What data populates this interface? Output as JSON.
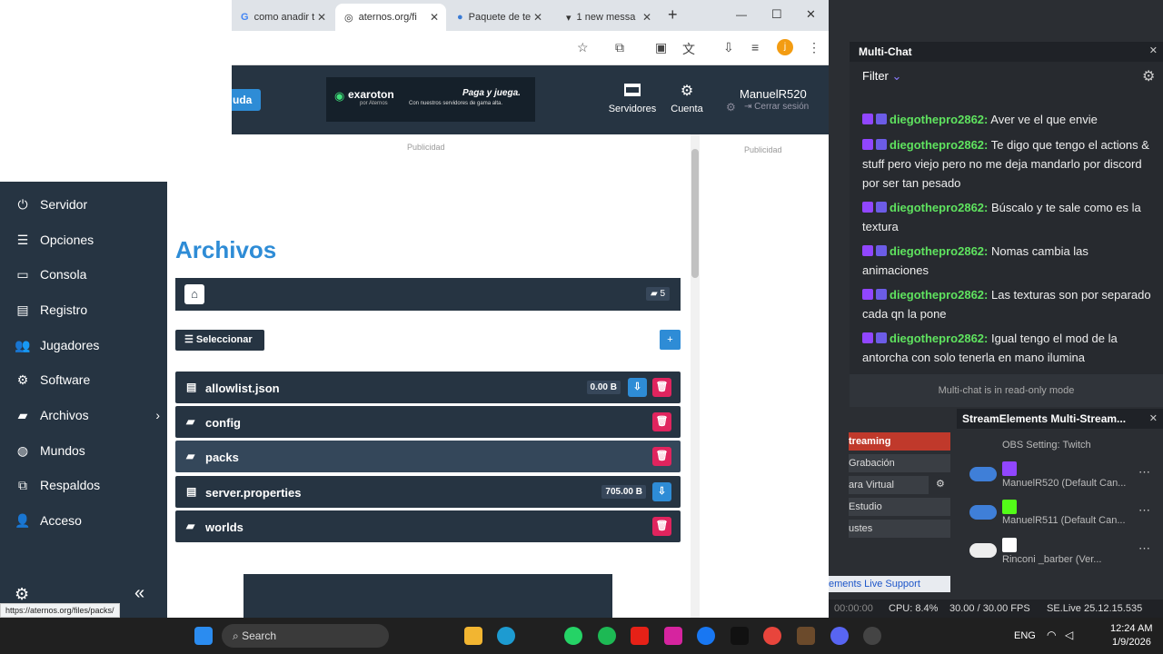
{
  "browser": {
    "tabs": [
      {
        "title": "como anadir t"
      },
      {
        "title": "aternos.org/fi"
      },
      {
        "title": "Paquete de te"
      },
      {
        "title": "1 new messa"
      }
    ],
    "new_tab": "+",
    "window_controls": {
      "min": "—",
      "max": "☐",
      "close": "✕"
    },
    "status_url": "https://aternos.org/files/packs/"
  },
  "site": {
    "ayuda": "uda",
    "ad": {
      "brand": "exaroton",
      "brand_sub": "por Aternos",
      "headline": "Paga y juega.",
      "sub": "Con nuestros servidores de gama alta."
    },
    "servidores": "Servidores",
    "cuenta": "Cuenta",
    "username": "ManuelR520",
    "logout": "Cerrar sesión",
    "publicidad": "Publicidad",
    "page_title": "Archivos",
    "folder_count": "5",
    "select_button": "Seleccionar",
    "files": [
      {
        "name": "allowlist.json",
        "type": "file",
        "size": "0.00 B"
      },
      {
        "name": "config",
        "type": "folder",
        "size": ""
      },
      {
        "name": "packs",
        "type": "folder",
        "size": ""
      },
      {
        "name": "server.properties",
        "type": "file",
        "size": "705.00 B"
      },
      {
        "name": "worlds",
        "type": "folder",
        "size": ""
      }
    ]
  },
  "sidebar": {
    "items": [
      {
        "label": "Servidor",
        "icon": "power-icon"
      },
      {
        "label": "Opciones",
        "icon": "list-icon"
      },
      {
        "label": "Consola",
        "icon": "terminal-icon"
      },
      {
        "label": "Registro",
        "icon": "file-icon"
      },
      {
        "label": "Jugadores",
        "icon": "users-icon"
      },
      {
        "label": "Software",
        "icon": "gears-icon"
      },
      {
        "label": "Archivos",
        "icon": "folder-icon"
      },
      {
        "label": "Mundos",
        "icon": "globe-icon"
      },
      {
        "label": "Respaldos",
        "icon": "clone-icon"
      },
      {
        "label": "Acceso",
        "icon": "user-icon"
      }
    ]
  },
  "stream": {
    "overlay_name": "manuelR520"
  },
  "multichat": {
    "title": "Multi-Chat",
    "filter": "Filter",
    "messages": [
      {
        "user": "diegothepro2862:",
        "text": "Aver ve el que envie"
      },
      {
        "user": "diegothepro2862:",
        "text": "Te digo que tengo el actions & stuff pero viejo pero no me deja mandarlo por discord por ser tan pesado"
      },
      {
        "user": "diegothepro2862:",
        "text": "Búscalo y te sale como es la textura"
      },
      {
        "user": "diegothepro2862:",
        "text": "Nomas cambia las animaciones"
      },
      {
        "user": "diegothepro2862:",
        "text": "Las texturas son por separado cada qn la pone"
      },
      {
        "user": "diegothepro2862:",
        "text": "Igual tengo el mod de la antorcha con solo tenerla en mano ilumina"
      }
    ],
    "readonly": "Multi-chat is in read-only mode"
  },
  "obs": {
    "controls": [
      "treaming",
      "Grabación",
      "ara Virtual",
      "Estudio",
      "ustes"
    ],
    "support": "ements Live Support",
    "se_title": "StreamElements Multi-Stream...",
    "se_items": [
      {
        "line": "OBS Setting: Twitch"
      },
      {
        "line": "ManuelR520 (Default Can..."
      },
      {
        "line": "ManuelR511 (Default Can..."
      },
      {
        "line": "Rinconi _barber (Ver..."
      }
    ],
    "status": {
      "time": "00:00:00",
      "cpu": "CPU: 8.4%",
      "fps": "30.00 / 30.00 FPS",
      "version": "SE.Live 25.12.15.535"
    }
  },
  "taskbar": {
    "search": "Search",
    "lang": "ENG",
    "time": "12:24 AM",
    "date": "1/9/2026"
  }
}
